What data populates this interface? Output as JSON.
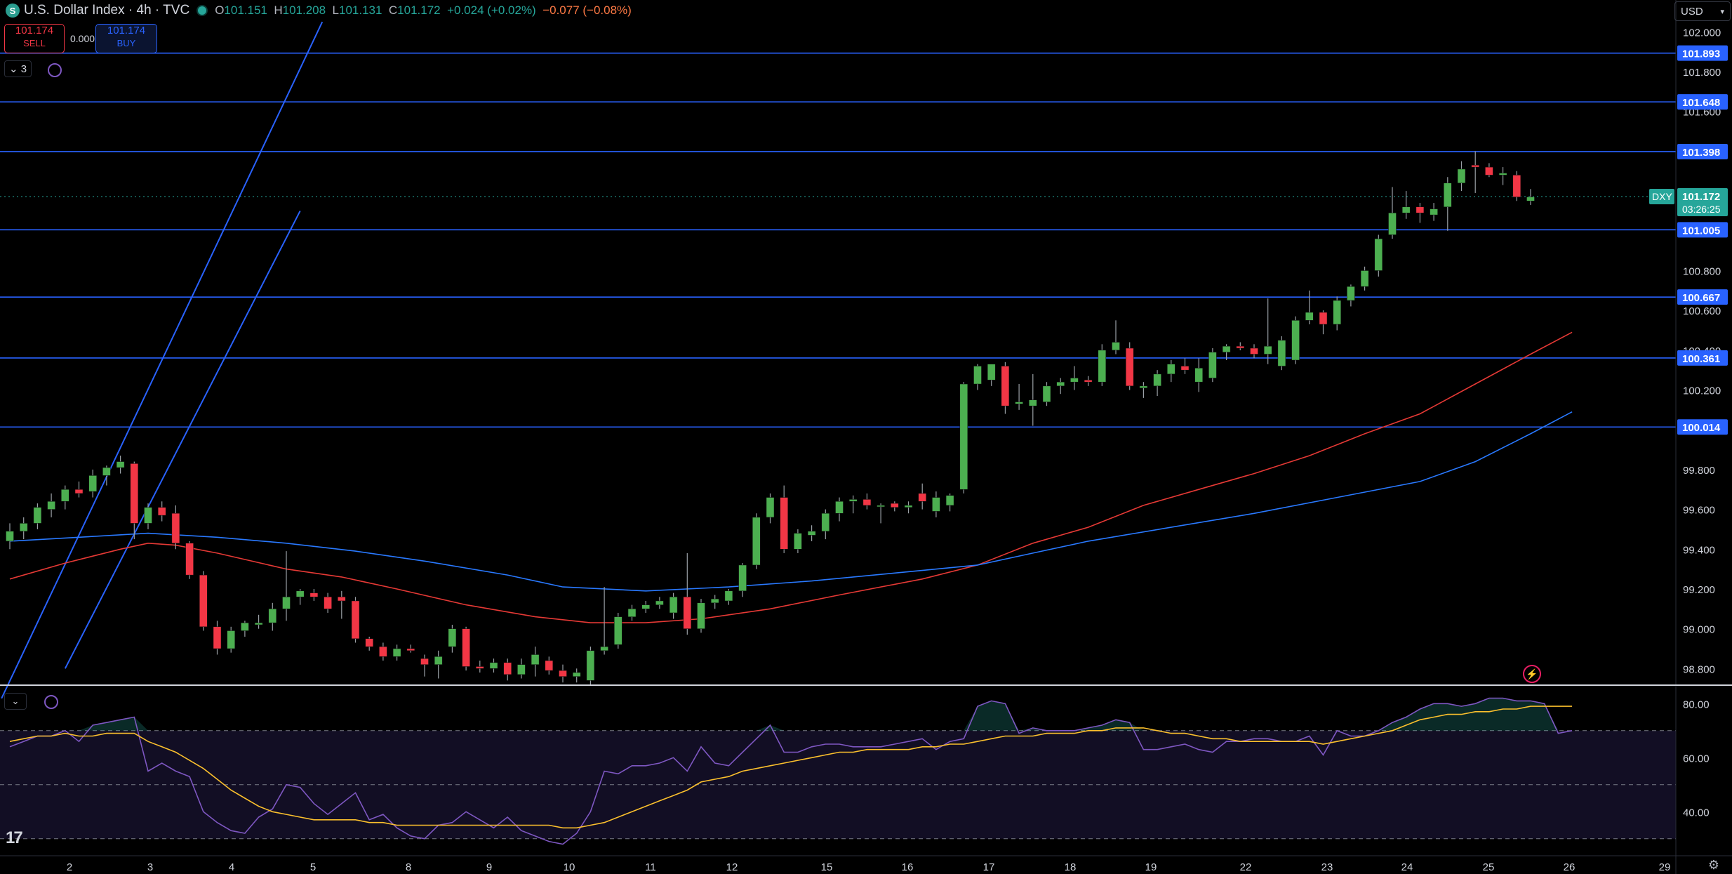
{
  "header": {
    "symbol_badge": "S",
    "title": "U.S. Dollar Index · 4h · TVC",
    "o_label": "O",
    "o_value": "101.151",
    "h_label": "H",
    "h_value": "101.208",
    "l_label": "L",
    "l_value": "101.131",
    "c_label": "C",
    "c_value": "101.172",
    "change": "+0.024 (+0.02%)",
    "change2": "−0.077 (−0.08%)"
  },
  "trade": {
    "sell_price": "101.174",
    "sell_label": "SELL",
    "spread": "0.000",
    "buy_price": "101.174",
    "buy_label": "BUY"
  },
  "indicators_count": "3",
  "currency": "USD",
  "icons": [
    "symbol-badge",
    "market-status-dot",
    "sync-icon",
    "chevron-down-icon",
    "lightning-icon",
    "tradingview-logo",
    "gear-icon"
  ],
  "colors": {
    "up": "#26a69a",
    "down": "#f23645",
    "line": "#2962ff",
    "ma_red": "#e53935",
    "ma_blue": "#2979ff",
    "rsi": "#7e57c2",
    "rsi_ma": "#fbc02d"
  },
  "chart_data": {
    "type": "candlestick",
    "symbol": "DXY",
    "last_price": "101.172",
    "countdown": "03:26:25",
    "y_ticks": [
      "102.000",
      "101.800",
      "101.600",
      "101.400",
      "101.200",
      "101.000",
      "100.800",
      "100.600",
      "100.400",
      "100.200",
      "100.000",
      "99.800",
      "99.600",
      "99.400",
      "99.200",
      "99.000",
      "98.800"
    ],
    "ylim": [
      98.72,
      102.16
    ],
    "x_ticks": [
      "2",
      "3",
      "4",
      "5",
      "8",
      "9",
      "10",
      "11",
      "12",
      "15",
      "16",
      "17",
      "18",
      "19",
      "22",
      "23",
      "24",
      "25",
      "26",
      "29"
    ],
    "horizontal_levels": [
      101.893,
      101.648,
      101.398,
      101.005,
      100.667,
      100.361,
      100.014
    ],
    "horizontal_level_labels": [
      "101.893",
      "101.648",
      "101.398",
      "101.005",
      "100.667",
      "100.361",
      "100.014"
    ],
    "channel": {
      "upper": [
        {
          "x": -0.6,
          "y": 98.65
        },
        {
          "x": 22.6,
          "y": 102.05
        }
      ],
      "lower": [
        {
          "x": 4.0,
          "y": 98.8
        },
        {
          "x": 21.0,
          "y": 101.1
        }
      ]
    },
    "candles": [
      {
        "o": 99.44,
        "h": 99.53,
        "l": 99.4,
        "c": 99.49
      },
      {
        "o": 99.49,
        "h": 99.56,
        "l": 99.45,
        "c": 99.53
      },
      {
        "o": 99.53,
        "h": 99.63,
        "l": 99.5,
        "c": 99.61
      },
      {
        "o": 99.6,
        "h": 99.68,
        "l": 99.56,
        "c": 99.64
      },
      {
        "o": 99.64,
        "h": 99.72,
        "l": 99.6,
        "c": 99.7
      },
      {
        "o": 99.7,
        "h": 99.74,
        "l": 99.66,
        "c": 99.68
      },
      {
        "o": 99.69,
        "h": 99.8,
        "l": 99.66,
        "c": 99.77
      },
      {
        "o": 99.77,
        "h": 99.82,
        "l": 99.72,
        "c": 99.81
      },
      {
        "o": 99.81,
        "h": 99.87,
        "l": 99.78,
        "c": 99.84
      },
      {
        "o": 99.83,
        "h": 99.84,
        "l": 99.45,
        "c": 99.53
      },
      {
        "o": 99.53,
        "h": 99.63,
        "l": 99.5,
        "c": 99.61
      },
      {
        "o": 99.61,
        "h": 99.64,
        "l": 99.54,
        "c": 99.57
      },
      {
        "o": 99.58,
        "h": 99.62,
        "l": 99.4,
        "c": 99.43
      },
      {
        "o": 99.43,
        "h": 99.44,
        "l": 99.25,
        "c": 99.27
      },
      {
        "o": 99.27,
        "h": 99.29,
        "l": 98.99,
        "c": 99.01
      },
      {
        "o": 99.01,
        "h": 99.04,
        "l": 98.87,
        "c": 98.9
      },
      {
        "o": 98.9,
        "h": 99.01,
        "l": 98.88,
        "c": 98.99
      },
      {
        "o": 98.99,
        "h": 99.04,
        "l": 98.96,
        "c": 99.03
      },
      {
        "o": 99.02,
        "h": 99.07,
        "l": 99.0,
        "c": 99.03
      },
      {
        "o": 99.03,
        "h": 99.13,
        "l": 98.99,
        "c": 99.1
      },
      {
        "o": 99.1,
        "h": 99.39,
        "l": 99.04,
        "c": 99.16
      },
      {
        "o": 99.16,
        "h": 99.2,
        "l": 99.12,
        "c": 99.19
      },
      {
        "o": 99.18,
        "h": 99.2,
        "l": 99.14,
        "c": 99.16
      },
      {
        "o": 99.16,
        "h": 99.18,
        "l": 99.08,
        "c": 99.1
      },
      {
        "o": 99.16,
        "h": 99.19,
        "l": 99.05,
        "c": 99.14
      },
      {
        "o": 99.14,
        "h": 99.16,
        "l": 98.93,
        "c": 98.95
      },
      {
        "o": 98.95,
        "h": 98.96,
        "l": 98.89,
        "c": 98.91
      },
      {
        "o": 98.91,
        "h": 98.93,
        "l": 98.84,
        "c": 98.86
      },
      {
        "o": 98.86,
        "h": 98.92,
        "l": 98.84,
        "c": 98.9
      },
      {
        "o": 98.9,
        "h": 98.92,
        "l": 98.88,
        "c": 98.89
      },
      {
        "o": 98.85,
        "h": 98.87,
        "l": 98.76,
        "c": 98.82
      },
      {
        "o": 98.82,
        "h": 98.89,
        "l": 98.75,
        "c": 98.86
      },
      {
        "o": 98.91,
        "h": 99.02,
        "l": 98.88,
        "c": 99.0
      },
      {
        "o": 99.0,
        "h": 99.01,
        "l": 98.79,
        "c": 98.81
      },
      {
        "o": 98.81,
        "h": 98.84,
        "l": 98.78,
        "c": 98.8
      },
      {
        "o": 98.8,
        "h": 98.85,
        "l": 98.78,
        "c": 98.83
      },
      {
        "o": 98.83,
        "h": 98.85,
        "l": 98.74,
        "c": 98.77
      },
      {
        "o": 98.77,
        "h": 98.85,
        "l": 98.75,
        "c": 98.82
      },
      {
        "o": 98.82,
        "h": 98.91,
        "l": 98.76,
        "c": 98.87
      },
      {
        "o": 98.84,
        "h": 98.86,
        "l": 98.77,
        "c": 98.79
      },
      {
        "o": 98.79,
        "h": 98.82,
        "l": 98.73,
        "c": 98.76
      },
      {
        "o": 98.76,
        "h": 98.8,
        "l": 98.73,
        "c": 98.78
      },
      {
        "o": 98.74,
        "h": 98.91,
        "l": 98.72,
        "c": 98.89
      },
      {
        "o": 98.89,
        "h": 99.21,
        "l": 98.87,
        "c": 98.91
      },
      {
        "o": 98.92,
        "h": 99.08,
        "l": 98.9,
        "c": 99.06
      },
      {
        "o": 99.06,
        "h": 99.12,
        "l": 99.04,
        "c": 99.1
      },
      {
        "o": 99.1,
        "h": 99.14,
        "l": 99.08,
        "c": 99.12
      },
      {
        "o": 99.12,
        "h": 99.16,
        "l": 99.1,
        "c": 99.14
      },
      {
        "o": 99.08,
        "h": 99.18,
        "l": 99.05,
        "c": 99.16
      },
      {
        "o": 99.16,
        "h": 99.38,
        "l": 98.97,
        "c": 99.0
      },
      {
        "o": 99.0,
        "h": 99.15,
        "l": 98.98,
        "c": 99.13
      },
      {
        "o": 99.13,
        "h": 99.17,
        "l": 99.1,
        "c": 99.15
      },
      {
        "o": 99.14,
        "h": 99.2,
        "l": 99.12,
        "c": 99.19
      },
      {
        "o": 99.19,
        "h": 99.33,
        "l": 99.16,
        "c": 99.32
      },
      {
        "o": 99.32,
        "h": 99.58,
        "l": 99.3,
        "c": 99.56
      },
      {
        "o": 99.56,
        "h": 99.68,
        "l": 99.53,
        "c": 99.66
      },
      {
        "o": 99.66,
        "h": 99.72,
        "l": 99.38,
        "c": 99.4
      },
      {
        "o": 99.4,
        "h": 99.5,
        "l": 99.38,
        "c": 99.48
      },
      {
        "o": 99.47,
        "h": 99.52,
        "l": 99.44,
        "c": 99.49
      },
      {
        "o": 99.49,
        "h": 99.6,
        "l": 99.45,
        "c": 99.58
      },
      {
        "o": 99.58,
        "h": 99.66,
        "l": 99.54,
        "c": 99.64
      },
      {
        "o": 99.64,
        "h": 99.67,
        "l": 99.58,
        "c": 99.65
      },
      {
        "o": 99.65,
        "h": 99.68,
        "l": 99.6,
        "c": 99.62
      },
      {
        "o": 99.62,
        "h": 99.63,
        "l": 99.53,
        "c": 99.62
      },
      {
        "o": 99.63,
        "h": 99.64,
        "l": 99.59,
        "c": 99.61
      },
      {
        "o": 99.61,
        "h": 99.64,
        "l": 99.58,
        "c": 99.62
      },
      {
        "o": 99.68,
        "h": 99.73,
        "l": 99.6,
        "c": 99.64
      },
      {
        "o": 99.59,
        "h": 99.69,
        "l": 99.56,
        "c": 99.66
      },
      {
        "o": 99.62,
        "h": 99.68,
        "l": 99.59,
        "c": 99.67
      },
      {
        "o": 99.7,
        "h": 100.24,
        "l": 99.68,
        "c": 100.23
      },
      {
        "o": 100.23,
        "h": 100.33,
        "l": 100.2,
        "c": 100.32
      },
      {
        "o": 100.25,
        "h": 100.33,
        "l": 100.22,
        "c": 100.33
      },
      {
        "o": 100.32,
        "h": 100.34,
        "l": 100.08,
        "c": 100.12
      },
      {
        "o": 100.13,
        "h": 100.23,
        "l": 100.1,
        "c": 100.14
      },
      {
        "o": 100.12,
        "h": 100.28,
        "l": 100.02,
        "c": 100.15
      },
      {
        "o": 100.14,
        "h": 100.24,
        "l": 100.12,
        "c": 100.22
      },
      {
        "o": 100.22,
        "h": 100.26,
        "l": 100.18,
        "c": 100.24
      },
      {
        "o": 100.24,
        "h": 100.32,
        "l": 100.2,
        "c": 100.26
      },
      {
        "o": 100.25,
        "h": 100.27,
        "l": 100.22,
        "c": 100.24
      },
      {
        "o": 100.24,
        "h": 100.43,
        "l": 100.22,
        "c": 100.4
      },
      {
        "o": 100.4,
        "h": 100.55,
        "l": 100.38,
        "c": 100.44
      },
      {
        "o": 100.41,
        "h": 100.44,
        "l": 100.2,
        "c": 100.22
      },
      {
        "o": 100.21,
        "h": 100.24,
        "l": 100.16,
        "c": 100.22
      },
      {
        "o": 100.22,
        "h": 100.3,
        "l": 100.17,
        "c": 100.28
      },
      {
        "o": 100.28,
        "h": 100.35,
        "l": 100.24,
        "c": 100.33
      },
      {
        "o": 100.32,
        "h": 100.36,
        "l": 100.28,
        "c": 100.3
      },
      {
        "o": 100.24,
        "h": 100.36,
        "l": 100.19,
        "c": 100.31
      },
      {
        "o": 100.26,
        "h": 100.41,
        "l": 100.24,
        "c": 100.39
      },
      {
        "o": 100.39,
        "h": 100.43,
        "l": 100.35,
        "c": 100.42
      },
      {
        "o": 100.42,
        "h": 100.44,
        "l": 100.4,
        "c": 100.41
      },
      {
        "o": 100.41,
        "h": 100.43,
        "l": 100.36,
        "c": 100.38
      },
      {
        "o": 100.38,
        "h": 100.66,
        "l": 100.33,
        "c": 100.42
      },
      {
        "o": 100.32,
        "h": 100.47,
        "l": 100.3,
        "c": 100.45
      },
      {
        "o": 100.35,
        "h": 100.57,
        "l": 100.33,
        "c": 100.55
      },
      {
        "o": 100.55,
        "h": 100.7,
        "l": 100.53,
        "c": 100.59
      },
      {
        "o": 100.59,
        "h": 100.6,
        "l": 100.48,
        "c": 100.53
      },
      {
        "o": 100.53,
        "h": 100.67,
        "l": 100.5,
        "c": 100.65
      },
      {
        "o": 100.65,
        "h": 100.73,
        "l": 100.62,
        "c": 100.72
      },
      {
        "o": 100.72,
        "h": 100.82,
        "l": 100.7,
        "c": 100.8
      },
      {
        "o": 100.8,
        "h": 100.98,
        "l": 100.77,
        "c": 100.96
      },
      {
        "o": 100.98,
        "h": 101.22,
        "l": 100.96,
        "c": 101.09
      },
      {
        "o": 101.09,
        "h": 101.2,
        "l": 101.06,
        "c": 101.12
      },
      {
        "o": 101.12,
        "h": 101.14,
        "l": 101.04,
        "c": 101.09
      },
      {
        "o": 101.08,
        "h": 101.14,
        "l": 101.05,
        "c": 101.11
      },
      {
        "o": 101.12,
        "h": 101.27,
        "l": 101.0,
        "c": 101.24
      },
      {
        "o": 101.24,
        "h": 101.35,
        "l": 101.2,
        "c": 101.31
      },
      {
        "o": 101.33,
        "h": 101.4,
        "l": 101.19,
        "c": 101.32
      },
      {
        "o": 101.32,
        "h": 101.34,
        "l": 101.27,
        "c": 101.28
      },
      {
        "o": 101.28,
        "h": 101.32,
        "l": 101.23,
        "c": 101.29
      },
      {
        "o": 101.28,
        "h": 101.3,
        "l": 101.15,
        "c": 101.17
      },
      {
        "o": 101.15,
        "h": 101.21,
        "l": 101.13,
        "c": 101.17
      }
    ],
    "ma_red": [
      [
        0,
        99.25
      ],
      [
        4,
        99.33
      ],
      [
        8,
        99.4
      ],
      [
        10,
        99.43
      ],
      [
        12,
        99.42
      ],
      [
        15,
        99.38
      ],
      [
        20,
        99.3
      ],
      [
        24,
        99.26
      ],
      [
        28,
        99.2
      ],
      [
        33,
        99.12
      ],
      [
        38,
        99.06
      ],
      [
        42,
        99.03
      ],
      [
        46,
        99.03
      ],
      [
        50,
        99.05
      ],
      [
        55,
        99.1
      ],
      [
        60,
        99.17
      ],
      [
        66,
        99.25
      ],
      [
        70,
        99.32
      ],
      [
        74,
        99.43
      ],
      [
        78,
        99.51
      ],
      [
        82,
        99.62
      ],
      [
        86,
        99.7
      ],
      [
        90,
        99.78
      ],
      [
        94,
        99.87
      ],
      [
        98,
        99.98
      ],
      [
        102,
        100.08
      ],
      [
        106,
        100.23
      ],
      [
        110,
        100.38
      ],
      [
        113,
        100.49
      ]
    ],
    "ma_blue": [
      [
        0,
        99.44
      ],
      [
        5,
        99.46
      ],
      [
        10,
        99.48
      ],
      [
        15,
        99.46
      ],
      [
        20,
        99.43
      ],
      [
        25,
        99.39
      ],
      [
        30,
        99.34
      ],
      [
        36,
        99.27
      ],
      [
        40,
        99.21
      ],
      [
        46,
        99.19
      ],
      [
        52,
        99.21
      ],
      [
        58,
        99.24
      ],
      [
        64,
        99.28
      ],
      [
        70,
        99.32
      ],
      [
        74,
        99.38
      ],
      [
        78,
        99.44
      ],
      [
        84,
        99.51
      ],
      [
        90,
        99.58
      ],
      [
        96,
        99.66
      ],
      [
        102,
        99.74
      ],
      [
        106,
        99.84
      ],
      [
        110,
        99.98
      ],
      [
        113,
        100.09
      ]
    ],
    "rsi": {
      "y_ticks": [
        "80.00",
        "60.00",
        "40.00"
      ],
      "ylim": [
        25,
        85
      ],
      "levels": [
        70,
        50,
        30
      ],
      "values": [
        64,
        66,
        68,
        68,
        70,
        66,
        72,
        73,
        74,
        75,
        55,
        58,
        55,
        53,
        40,
        36,
        33,
        32,
        38,
        41,
        50,
        49,
        43,
        39,
        43,
        47,
        37,
        39,
        34,
        31,
        30,
        35,
        36,
        40,
        37,
        34,
        38,
        33,
        31,
        29,
        28,
        32,
        40,
        55,
        54,
        57,
        57,
        58,
        60,
        55,
        64,
        58,
        57,
        62,
        67,
        72,
        62,
        62,
        64,
        65,
        65,
        64,
        64,
        64,
        65,
        66,
        67,
        63,
        66,
        67,
        79,
        81,
        80,
        69,
        71,
        70,
        70,
        70,
        71,
        72,
        74,
        73,
        63,
        63,
        64,
        65,
        63,
        62,
        66,
        66,
        67,
        67,
        66,
        66,
        68,
        61,
        70,
        68,
        68,
        70,
        73,
        75,
        78,
        80,
        80,
        79,
        80,
        82,
        82,
        81,
        81,
        80,
        69,
        70
      ],
      "ma": [
        66,
        67,
        68,
        68,
        69,
        68,
        68,
        69,
        69,
        69,
        66,
        64,
        62,
        59,
        56,
        52,
        48,
        45,
        42,
        40,
        39,
        38,
        37,
        37,
        37,
        37,
        36,
        36,
        35,
        35,
        35,
        35,
        35,
        35,
        35,
        35,
        35,
        35,
        35,
        35,
        34,
        34,
        35,
        36,
        38,
        40,
        42,
        44,
        46,
        48,
        51,
        52,
        53,
        55,
        56,
        57,
        58,
        59,
        60,
        61,
        62,
        62,
        63,
        63,
        63,
        63,
        64,
        64,
        65,
        65,
        66,
        67,
        68,
        68,
        68,
        69,
        69,
        69,
        70,
        70,
        71,
        71,
        71,
        70,
        69,
        69,
        68,
        67,
        67,
        66,
        66,
        66,
        66,
        66,
        66,
        65,
        66,
        67,
        68,
        69,
        70,
        72,
        74,
        75,
        76,
        76,
        77,
        77,
        78,
        78,
        79,
        79,
        79,
        79
      ]
    }
  }
}
